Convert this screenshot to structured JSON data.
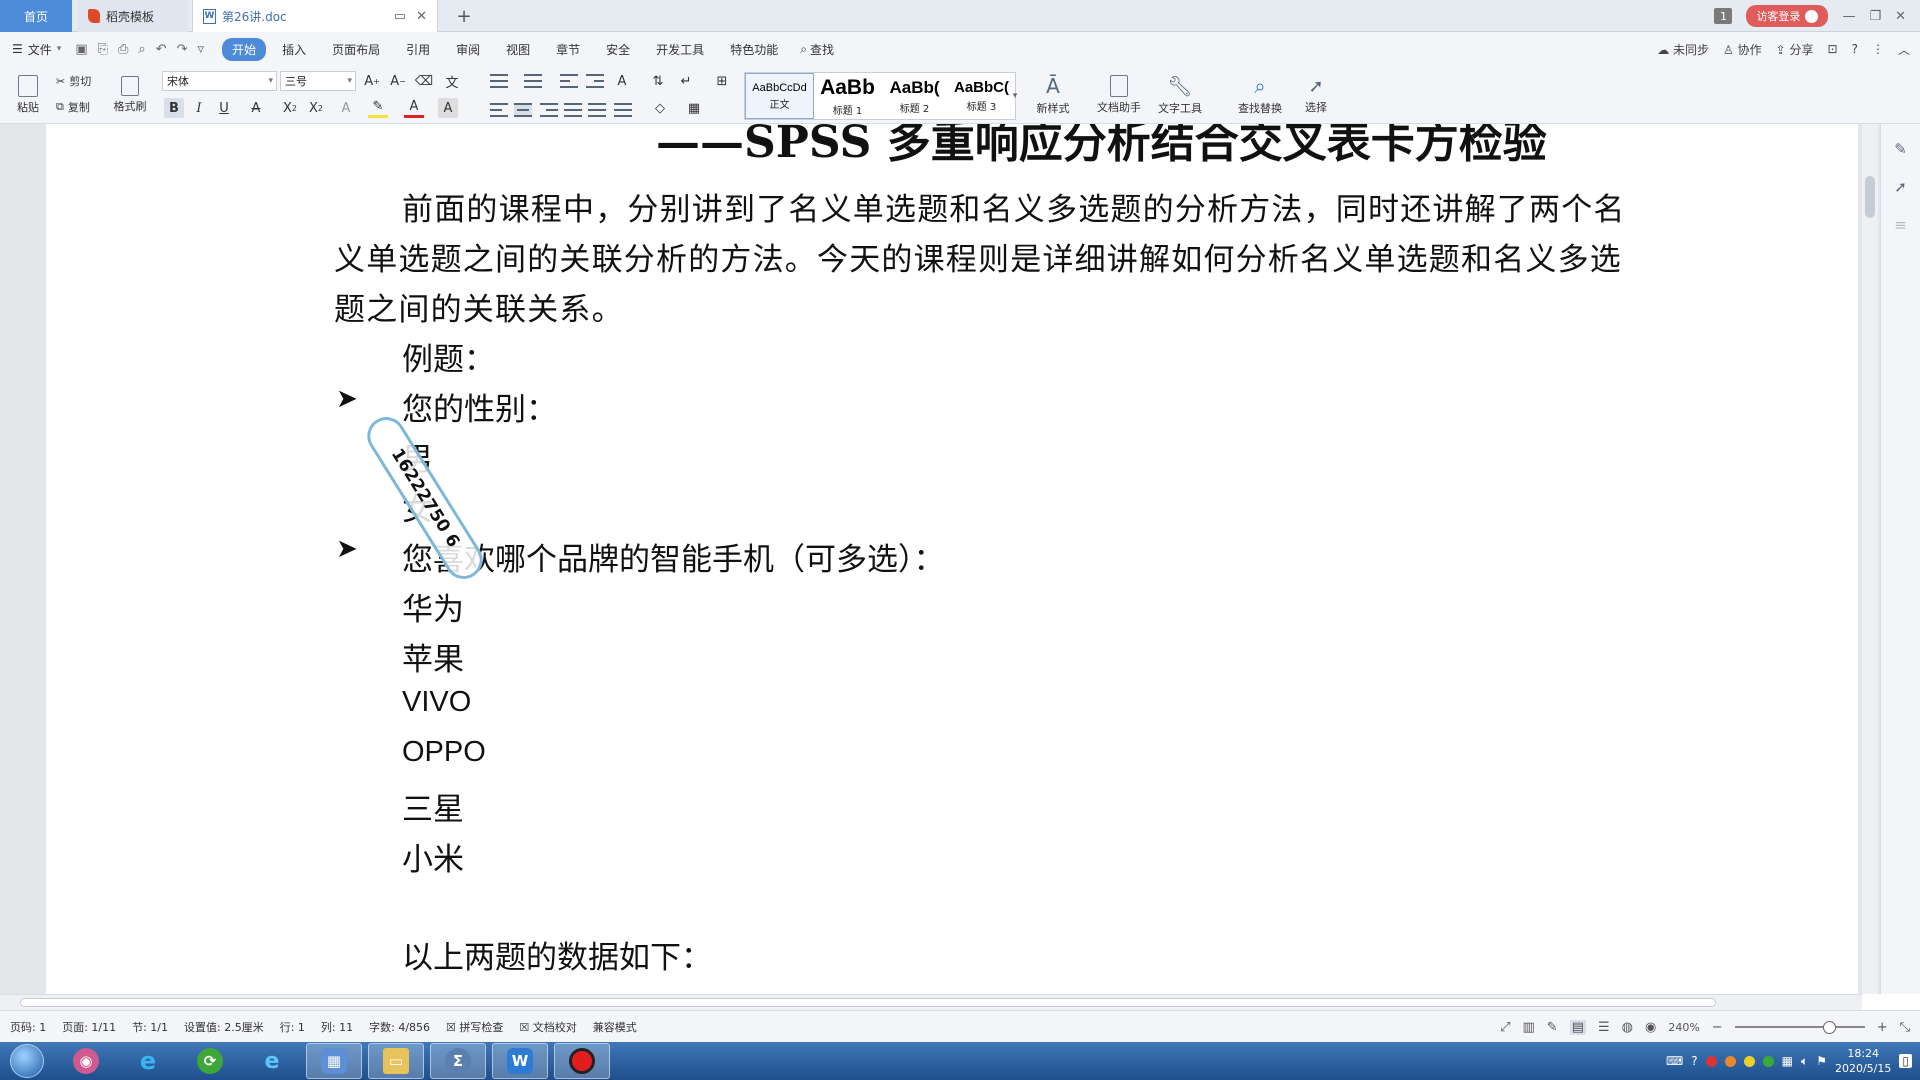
{
  "tabs": {
    "home": "首页",
    "template": "稻壳模板",
    "document": "第26讲.doc",
    "doc_icon_letter": "W"
  },
  "titlebar_right": {
    "count": "1",
    "login": "访客登录"
  },
  "menu": {
    "file": "文件",
    "items": [
      "开始",
      "插入",
      "页面布局",
      "引用",
      "审阅",
      "视图",
      "章节",
      "安全",
      "开发工具",
      "特色功能"
    ],
    "active_index": 0,
    "search": "查找",
    "right": [
      "未同步",
      "协作",
      "分享"
    ]
  },
  "ribbon": {
    "paste": "粘贴",
    "cut": "剪切",
    "copy": "复制",
    "format_painter": "格式刷",
    "font_name": "宋体",
    "font_size": "三号",
    "styles": [
      {
        "sample": "AaBbCcDd",
        "name": "正文"
      },
      {
        "sample": "AaBb",
        "name": "标题 1"
      },
      {
        "sample": "AaBb(",
        "name": "标题 2"
      },
      {
        "sample": "AaBbC(",
        "name": "标题 3"
      }
    ],
    "new_style": "新样式",
    "doc_assistant": "文档助手",
    "text_tools": "文字工具",
    "find_replace": "查找替换",
    "select": "选择"
  },
  "document": {
    "heading": "——SPSS 多重响应分析结合交叉表卡方检验",
    "intro_lines": [
      "前面的课程中，分别讲到了名义单选题和名义多选题的分析方法，同时还讲解了两个名",
      "义单选题之间的关联分析的方法。今天的课程则是详细讲解如何分析名义单选题和名义多选",
      "题之间的关联关系。"
    ],
    "example_label": "例题：",
    "q1": "您的性别：",
    "q1_options": [
      "男",
      "女"
    ],
    "q2": "您喜欢哪个品牌的智能手机（可多选）：",
    "q2_options": [
      "华为",
      "苹果",
      "VIVO",
      "OPPO",
      "三星",
      "小米"
    ],
    "data_intro": "以上两题的数据如下：",
    "watermark_text": "16222750 6"
  },
  "statusbar": {
    "page_num": "页码: 1",
    "pages": "页面: 1/11",
    "section": "节: 1/1",
    "setting": "设置值: 2.5厘米",
    "row": "行: 1",
    "col": "列: 11",
    "words": "字数: 4/856",
    "spell_check": "拼写检查",
    "doc_check": "文档校对",
    "compat": "兼容模式",
    "zoom": "240%"
  },
  "taskbar": {
    "time": "18:24",
    "date": "2020/5/15"
  },
  "colors": {
    "accent": "#4d8bd8",
    "login": "#e05b5b",
    "taskbar": "#2a62a3"
  }
}
